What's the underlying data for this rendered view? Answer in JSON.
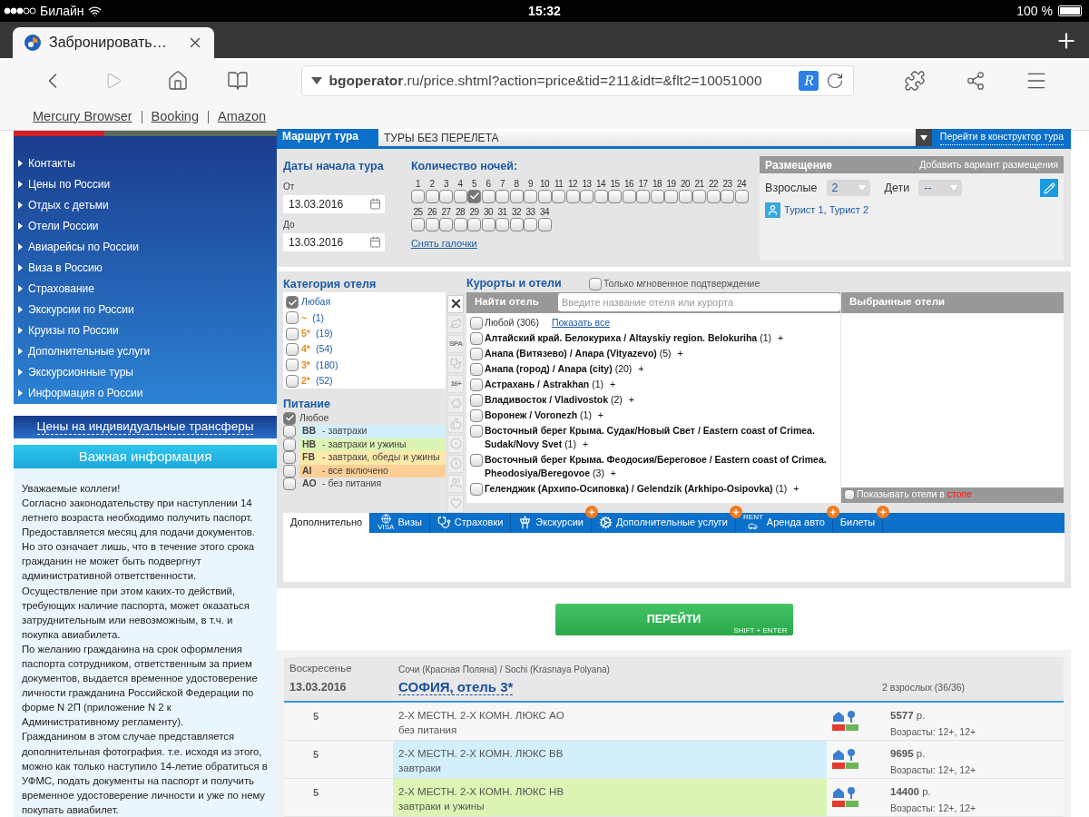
{
  "status_bar": {
    "carrier": "Билайн",
    "time": "15:32",
    "battery": "100 %"
  },
  "browser": {
    "tab_title": "Забронировать…",
    "url": "**bgoperator**.ru/price.shtml?action=price&tid=211&idt=&flt2=10051000",
    "reader_button": "R",
    "forward_disabled": true,
    "bookmarks": [
      "Mercury Browser",
      "Booking",
      "Amazon"
    ]
  },
  "sidebar": {
    "nav": [
      "Контакты",
      "Цены по России",
      "Отдых с детьми",
      "Отели России",
      "Авиарейсы по России",
      "Виза в Россию",
      "Страхование",
      "Экскурсии по России",
      "Круизы по России",
      "Дополнительные услуги",
      "Экскурсионные туры",
      "Информация о России"
    ],
    "transfers_link": "Цены на индивидуальные трансферы",
    "info_title": "Важная информация",
    "info_paragraphs": [
      "Уважаемые коллеги!",
      "Согласно законодательству при наступлении 14 летнего возраста необходимо получить паспорт.",
      "Предоставляется месяц для подачи документов.",
      "Но это означает лишь, что в течение этого срока гражданин не может быть подвергнут административной ответственности.",
      "Осуществление при этом каких-то действий, требующих наличие паспорта, может оказаться затруднительным или невозможным, в т.ч. и покупка авиабилета.",
      "По желанию гражданина на срок оформления паспорта сотрудником,  ответственным за прием документов, выдается временное удостоверение личности гражданина Российской Федерации по форме N 2П (приложение N 2 к Административному  регламенту).",
      "Гражданином в этом случае представляется дополнительная фотография. т.е.  исходя из этого, можно как только наступило 14-летие обратиться в УФМС, подать документы на паспорт и получить временное удостоверение личности и уже по нему покупать авиабилет."
    ]
  },
  "route": {
    "label": "Маршрут тура",
    "value": "ТУРЫ БЕЗ ПЕРЕЛЕТА",
    "constructor_link": "Перейти в конструктор тура"
  },
  "dates": {
    "title": "Даты начала тура",
    "from_label": "От",
    "from": "13.03.2016",
    "to_label": "До",
    "to": "13.03.2016"
  },
  "nights": {
    "title": "Количество ночей:",
    "clear_link": "Снять галочки",
    "items": [
      {
        "label": "1",
        "checked": false
      },
      {
        "label": "2",
        "checked": false
      },
      {
        "label": "3",
        "checked": false
      },
      {
        "label": "4",
        "checked": false
      },
      {
        "label": "5",
        "checked": true
      },
      {
        "label": "6",
        "checked": false
      },
      {
        "label": "7",
        "checked": false
      },
      {
        "label": "8",
        "checked": false
      },
      {
        "label": "9",
        "checked": false
      },
      {
        "label": "10",
        "checked": false
      },
      {
        "label": "11",
        "checked": false
      },
      {
        "label": "12",
        "checked": false
      },
      {
        "label": "13",
        "checked": false
      },
      {
        "label": "14",
        "checked": false
      },
      {
        "label": "15",
        "checked": false
      },
      {
        "label": "16",
        "checked": false
      },
      {
        "label": "17",
        "checked": false
      },
      {
        "label": "18",
        "checked": false
      },
      {
        "label": "19",
        "checked": false
      },
      {
        "label": "20",
        "checked": false
      },
      {
        "label": "21",
        "checked": false
      },
      {
        "label": "22",
        "checked": false
      },
      {
        "label": "23",
        "checked": false
      },
      {
        "label": "24",
        "checked": false
      },
      {
        "label": "25",
        "checked": false
      },
      {
        "label": "26",
        "checked": false
      },
      {
        "label": "27",
        "checked": false
      },
      {
        "label": "28",
        "checked": false
      },
      {
        "label": "29",
        "checked": false
      },
      {
        "label": "30",
        "checked": false
      },
      {
        "label": "31",
        "checked": false
      },
      {
        "label": "32",
        "checked": false
      },
      {
        "label": "33",
        "checked": false
      },
      {
        "label": "34",
        "checked": false
      }
    ]
  },
  "accommodation": {
    "title": "Размещение",
    "add_link": "Добавить вариант размещения",
    "adults_label": "Взрослые",
    "adults": "2",
    "children_label": "Дети",
    "children": "--",
    "tourists": "Турист 1, Турист 2"
  },
  "hotel_category": {
    "title": "Категория отеля",
    "items": [
      {
        "label": "Любая",
        "checked": true
      },
      {
        "stars": "~",
        "count": "(1)",
        "checked": false
      },
      {
        "stars": "5*",
        "count": "(19)",
        "checked": false
      },
      {
        "stars": "4*",
        "count": "(54)",
        "checked": false
      },
      {
        "stars": "3*",
        "count": "(180)",
        "checked": false
      },
      {
        "stars": "2*",
        "count": "(52)",
        "checked": false
      }
    ]
  },
  "meals": {
    "title": "Питание",
    "items": [
      {
        "label": "Любое",
        "checked": true
      },
      {
        "code": "BB",
        "desc": "- завтраки",
        "color": "#d2effa",
        "checked": false
      },
      {
        "code": "HB",
        "desc": "- завтраки и ужины",
        "color": "#dcf5b4",
        "checked": false
      },
      {
        "code": "FB",
        "desc": "- завтраки, обеды и ужины",
        "color": "#fde9a8",
        "checked": false
      },
      {
        "code": "AI",
        "desc": "- все включено",
        "color": "#fbcf95",
        "checked": false
      },
      {
        "code": "AO",
        "desc": "- без питания",
        "checked": false
      }
    ]
  },
  "filter_icons": [
    {
      "kind": "close"
    },
    {
      "kind": "palm"
    },
    {
      "kind": "text",
      "label": "SPA"
    },
    {
      "kind": "medical"
    },
    {
      "kind": "text",
      "label": "16+"
    },
    {
      "kind": "pig"
    },
    {
      "kind": "thumb"
    },
    {
      "kind": "ball"
    },
    {
      "kind": "clock"
    },
    {
      "kind": "people"
    },
    {
      "kind": "heart"
    }
  ],
  "resorts": {
    "title": "Курорты и отели",
    "instant_label": "Только мгновенное подтверждение",
    "instant": false,
    "search_label": "Найти отель",
    "search_placeholder": "Введите название отеля или курорта",
    "selected_title": "Выбранные отели",
    "stop_label": "Показывать отели в",
    "stop_highlight": "стопе",
    "stop": false,
    "items": [
      {
        "kind": "any",
        "name": "Любой (306)",
        "link": "Показать все",
        "checked": false
      },
      {
        "kind": "resort",
        "name": "Алтайский край. Белокуриха / Altayskiy region. Belokuriha",
        "count": "(1)",
        "add": "+",
        "checked": false
      },
      {
        "kind": "resort",
        "name": "Анапа (Витязево) / Anapa (Vityazevo)",
        "count": "(5)",
        "add": "+",
        "checked": false
      },
      {
        "kind": "resort",
        "name": "Анапа (город) / Anapa (city)",
        "count": "(20)",
        "add": "+",
        "checked": false
      },
      {
        "kind": "resort",
        "name": "Астрахань / Astrakhan",
        "count": "(1)",
        "add": "+",
        "checked": false
      },
      {
        "kind": "resort",
        "name": "Владивосток / Vladivostok",
        "count": "(2)",
        "add": "+",
        "checked": false
      },
      {
        "kind": "resort",
        "name": "Воронеж / Voronezh",
        "count": "(1)",
        "add": "+",
        "checked": false
      },
      {
        "kind": "resort",
        "name": "Восточный берег Крыма. Судак/Новый Свет / Eastern coast of Crimea. Sudak/Novy Svet",
        "count": "(1)",
        "add": "+",
        "checked": false
      },
      {
        "kind": "resort",
        "name": "Восточный берег Крыма. Феодосия/Береговое / Eastern coast of Crimea. Pheodosiya/Beregovoe",
        "count": "(3)",
        "add": "+",
        "checked": false
      },
      {
        "kind": "resort",
        "name": "Геленджик (Архипо-Осиповка) / Gelendzik (Arkhipo-Osipovka)",
        "count": "(1)",
        "add": "+",
        "checked": false
      }
    ]
  },
  "service_tabs": [
    {
      "label": "Дополнительно",
      "kind": "plain",
      "selected": true,
      "badge": false
    },
    {
      "label": "Визы",
      "kind": "visa",
      "icon_text": "VISA",
      "selected": false,
      "badge": false
    },
    {
      "label": "Страховки",
      "kind": "insurance",
      "selected": false,
      "badge": false
    },
    {
      "label": "Экскурсии",
      "kind": "excursion",
      "selected": false,
      "badge": true
    },
    {
      "label": "Дополнительные услуги",
      "kind": "services",
      "selected": false,
      "badge": true
    },
    {
      "label": "Аренда авто",
      "kind": "rental",
      "icon_text": "RENT",
      "selected": false,
      "badge": true
    },
    {
      "label": "Билеты",
      "kind": "plain",
      "selected": false,
      "badge": true
    }
  ],
  "submit": {
    "label": "ПЕРЕЙТИ",
    "hint": "SHIFT + ENTER"
  },
  "results": {
    "day": "Воскресенье",
    "date": "13.03.2016",
    "location": "Сочи (Красная Поляна) / Sochi (Krasnaya Polyana)",
    "hotel": "СОФИЯ, отель 3*",
    "guests": "2 взрослых (36/36)",
    "rows": [
      {
        "nights": "5",
        "room": "2-Х МЕСТН. 2-Х КОМН. ЛЮКС AO",
        "meal": "без питания",
        "price": "5577",
        "currency": "р.",
        "ages": "Возрасты: 12+, 12+"
      },
      {
        "nights": "5",
        "room": "2-Х МЕСТН. 2-Х КОМН. ЛЮКС BB",
        "meal": "завтраки",
        "color": "#d2effa",
        "price": "9695",
        "currency": "р.",
        "ages": "Возрасты: 12+, 12+"
      },
      {
        "nights": "5",
        "room": "2-Х МЕСТН. 2-Х КОМН. ЛЮКС HB",
        "meal": "завтраки и ужины",
        "color": "#dcf5b4",
        "price": "14400",
        "currency": "р.",
        "ages": "Возрасты: 12+, 12+"
      }
    ]
  }
}
